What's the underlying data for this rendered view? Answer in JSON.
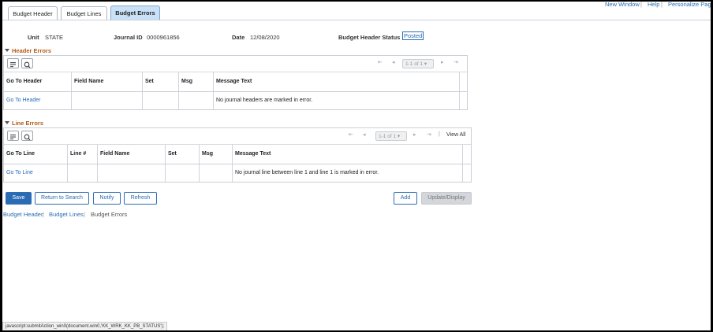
{
  "tabs": [
    {
      "label": "Budget Header"
    },
    {
      "label": "Budget Lines"
    },
    {
      "label": "Budget Errors"
    }
  ],
  "top_links": {
    "new_window": "New Window",
    "help": "Help",
    "personalize": "Personalize Page"
  },
  "info": {
    "unit_label": "Unit",
    "unit_value": "STATE",
    "journal_label": "Journal ID",
    "journal_value": "0000961856",
    "date_label": "Date",
    "date_value": "12/08/2020",
    "status_label": "Budget Header Status",
    "status_value": "Posted"
  },
  "header_errors": {
    "title": "Header Errors",
    "pager": "1-1 of 1",
    "columns": [
      "Go To Header",
      "Field Name",
      "Set",
      "Msg",
      "Message Text"
    ],
    "row": {
      "link": "Go To Header",
      "message": "No journal headers are marked in error."
    }
  },
  "line_errors": {
    "title": "Line Errors",
    "pager": "1-1 of 1",
    "view_all": "View All",
    "columns": [
      "Go To Line",
      "Line #",
      "Field Name",
      "Set",
      "Msg",
      "Message Text"
    ],
    "row": {
      "link": "Go To Line",
      "message": "No journal line between line 1 and line 1 is marked in error."
    }
  },
  "buttons": {
    "save": "Save",
    "return": "Return to Search",
    "notify": "Notify",
    "refresh": "Refresh",
    "add": "Add",
    "update": "Update/Display"
  },
  "bottom_nav": {
    "header": "Budget Header",
    "lines": "Budget Lines",
    "errors": "Budget Errors"
  },
  "status_bar": "javascript:submitAction_win0(document.win0,'KK_WRK_KK_PB_STATUS');"
}
